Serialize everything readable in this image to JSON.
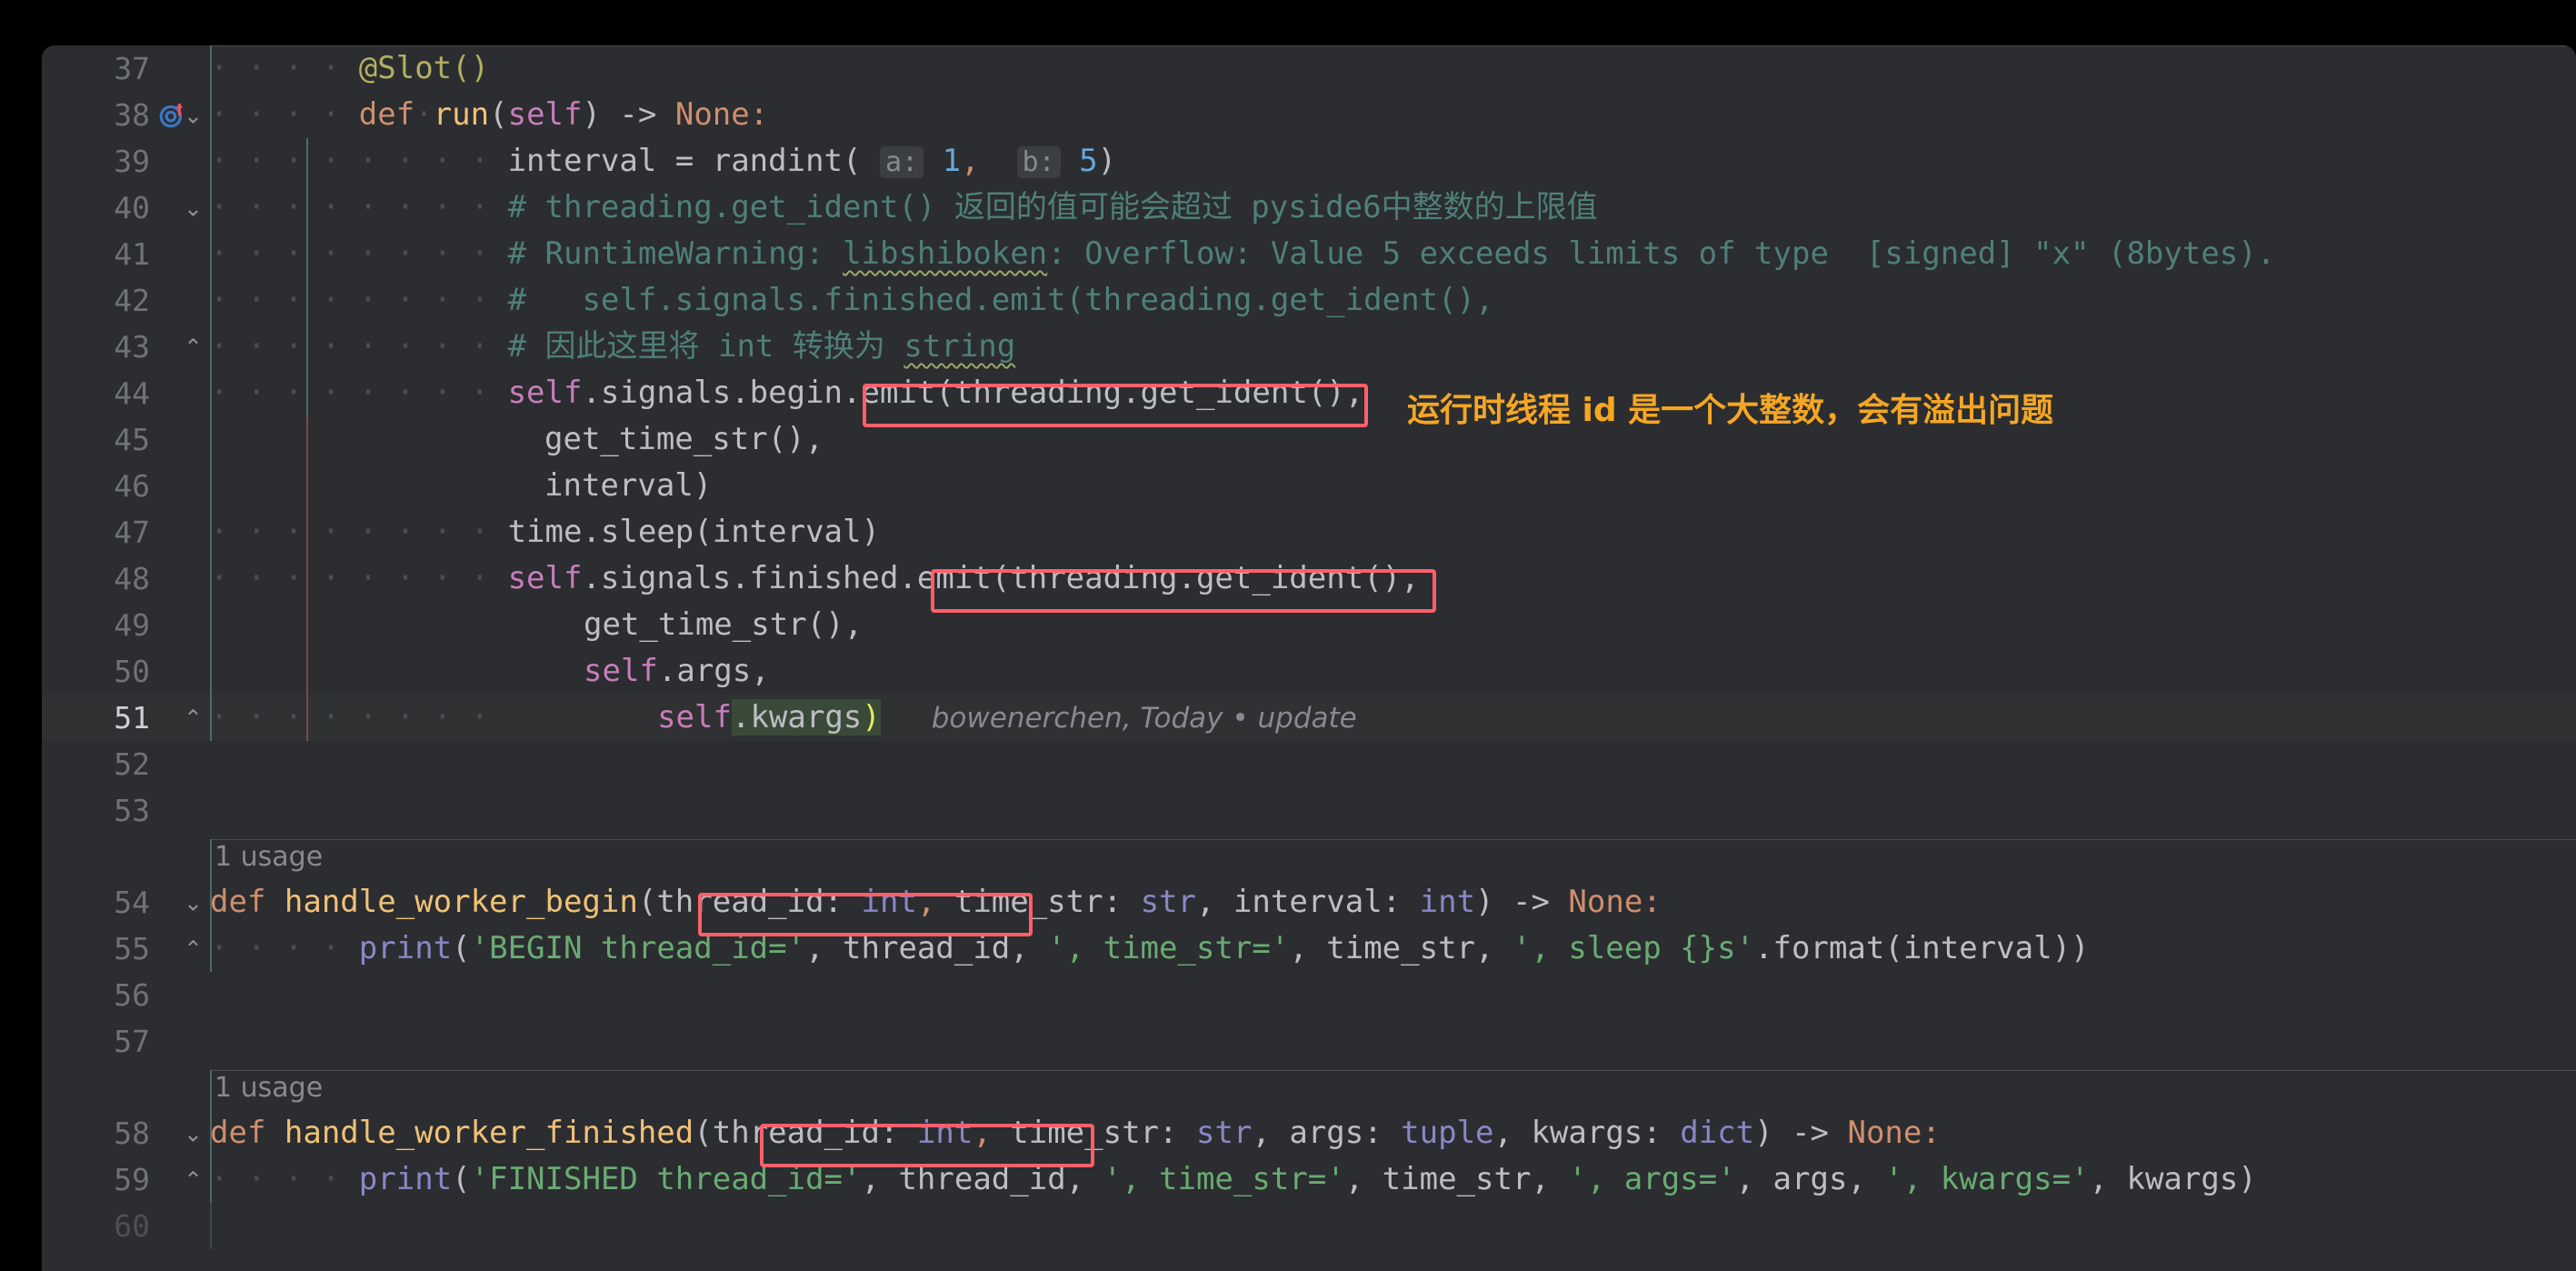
{
  "editor": {
    "app": "jetbrains-dark-code-editor",
    "language": "python",
    "theme_bg": "#2b2d30",
    "accent_annotation": "#ff5f6b",
    "annotation_text_color": "#f5a623"
  },
  "lines": [
    {
      "n": "37",
      "text": "        @Slot()"
    },
    {
      "n": "38",
      "text": "        def run(self) -> None:"
    },
    {
      "n": "39",
      "text": "            interval = randint( a: 1,  b: 5)"
    },
    {
      "n": "40",
      "text": "            # threading.get_ident() 返回的值可能会超过 pyside6中整数的上限值"
    },
    {
      "n": "41",
      "text": "            # RuntimeWarning: libshiboken: Overflow: Value 5 exceeds limits of type  [signed] \"x\" (8bytes)."
    },
    {
      "n": "42",
      "text": "            #   self.signals.finished.emit(threading.get_ident(),"
    },
    {
      "n": "43",
      "text": "            # 因此这里将 int 转换为 string"
    },
    {
      "n": "44",
      "text": "            self.signals.begin.emit(threading.get_ident(),"
    },
    {
      "n": "45",
      "text": "                                    get_time_str(),"
    },
    {
      "n": "46",
      "text": "                                    interval)"
    },
    {
      "n": "47",
      "text": "            time.sleep(interval)"
    },
    {
      "n": "48",
      "text": "            self.signals.finished.emit(threading.get_ident(),"
    },
    {
      "n": "49",
      "text": "                                       get_time_str(),"
    },
    {
      "n": "50",
      "text": "                                       self.args,"
    },
    {
      "n": "51",
      "text": "                                       self.kwargs)"
    },
    {
      "n": "52",
      "text": ""
    },
    {
      "n": "53",
      "text": ""
    },
    {
      "n": "54",
      "text": "def handle_worker_begin(thread_id: int, time_str: str, interval: int) -> None:"
    },
    {
      "n": "55",
      "text": "    print('BEGIN thread_id=', thread_id, ', time_str=', time_str, ', sleep {}s'.format(interval))"
    },
    {
      "n": "56",
      "text": ""
    },
    {
      "n": "57",
      "text": ""
    },
    {
      "n": "58",
      "text": "def handle_worker_finished(thread_id: int, time_str: str, args: tuple, kwargs: dict) -> None:"
    },
    {
      "n": "59",
      "text": "    print('FINISHED thread_id=', thread_id, ', time_str=', time_str, ', args=', args, ', kwargs=', kwargs)"
    },
    {
      "n": "60",
      "text": ""
    }
  ],
  "line_numbers": {
    "l37": "37",
    "l38": "38",
    "l39": "39",
    "l40": "40",
    "l41": "41",
    "l42": "42",
    "l43": "43",
    "l44": "44",
    "l45": "45",
    "l46": "46",
    "l47": "47",
    "l48": "48",
    "l49": "49",
    "l50": "50",
    "l51": "51",
    "l52": "52",
    "l53": "53",
    "l54": "54",
    "l55": "55",
    "l56": "56",
    "l57": "57",
    "l58": "58",
    "l59": "59",
    "l60": "60"
  },
  "tokens": {
    "decorator_slot": "@Slot()",
    "kw_def": "def",
    "fn_run": "run",
    "self": "self",
    "arrow": ") -> ",
    "none_colon": "None:",
    "interval_assign": "interval = randint(",
    "hint_a": "a:",
    "num_1": "1",
    "hint_b": "b:",
    "num_5": "5",
    "comment40": "# threading.get_ident() 返回的值可能会超过 pyside6中整数的上限值",
    "comment41_pre": "# RuntimeWarning: ",
    "comment41_mis": "libshiboken",
    "comment41_post": ": Overflow: Value 5 exceeds limits of type  [signed] \"x\" (8bytes).",
    "comment42": "#   self.signals.finished.emit(threading.get_ident(),",
    "comment43_pre": "# 因此这里将 ",
    "comment43_int": "int",
    "comment43_mid": " 转换为 ",
    "comment43_str": "string",
    "l44_self": "self",
    "l44_sig": ".signals.begin.emit(",
    "l44_box": "threading.get_ident(),",
    "l45_text": "get_time_str(),",
    "l46_text": "interval)",
    "l47_text": "time.sleep(interval)",
    "l48_self": "self",
    "l48_sig": ".signals.finished.emit(",
    "l48_box": "threading.get_ident(),",
    "l49_text": "get_time_str(),",
    "l50_self": "self",
    "l50_args": ".args,",
    "l51_self": "self",
    "l51_kwargs": ".kwargs",
    "l51_paren": ")",
    "usage_label": "1 usage",
    "l54_def": "def",
    "l54_fn": " handle_worker_begin",
    "l54_open": "(",
    "l54_param": "thread_id: ",
    "l54_int": "int",
    "l54_comma": ",",
    "l54_rest_a": " time_str: ",
    "l54_str": "str",
    "l54_rest_b": ", interval: ",
    "l54_int2": "int",
    "l54_rest_c": ") -> ",
    "l54_none": "None:",
    "l55_print": "print",
    "l55_s1": "'BEGIN thread_id='",
    "l55_v1": ", thread_id, ",
    "l55_s2": "', time_str='",
    "l55_v2": ", time_str, ",
    "l55_s3": "', sleep {}s'",
    "l55_tail": ".format(interval))",
    "l58_def": "def",
    "l58_fn": " handle_worker_finished",
    "l58_open": "(",
    "l58_param": "thread_id: ",
    "l58_int": "int",
    "l58_comma": ",",
    "l58_rest_a": " time_str: ",
    "l58_str": "str",
    "l58_rest_b": ", args: ",
    "l58_tuple": "tuple",
    "l58_rest_c": ", kwargs: ",
    "l58_dict": "dict",
    "l58_rest_d": ") -> ",
    "l58_none": "None:",
    "l59_print": "print",
    "l59_s1": "'FINISHED thread_id='",
    "l59_v1": ", thread_id, ",
    "l59_s2": "', time_str='",
    "l59_v2": ", time_str, ",
    "l59_s3": "', args='",
    "l59_v3": ", args, ",
    "l59_s4": "', kwargs='",
    "l59_v4": ", kwargs)"
  },
  "blame": {
    "author": "bowenerchen,",
    "when": "Today",
    "bullet": "•",
    "message": "update"
  },
  "annotation": {
    "note_text": "运行时线程 id 是一个大整数，会有溢出问题",
    "boxes": [
      {
        "name": "box-line-44-threading-get-ident"
      },
      {
        "name": "box-line-48-threading-get-ident"
      },
      {
        "name": "box-line-54-thread-id-int"
      },
      {
        "name": "box-line-58-thread-id-int"
      }
    ]
  },
  "dots": {
    "d4": "· · · ·",
    "d8": "· · · · · · · ·",
    "d12": "· · · · · · · · · · · ·",
    "d2": "· ·"
  }
}
